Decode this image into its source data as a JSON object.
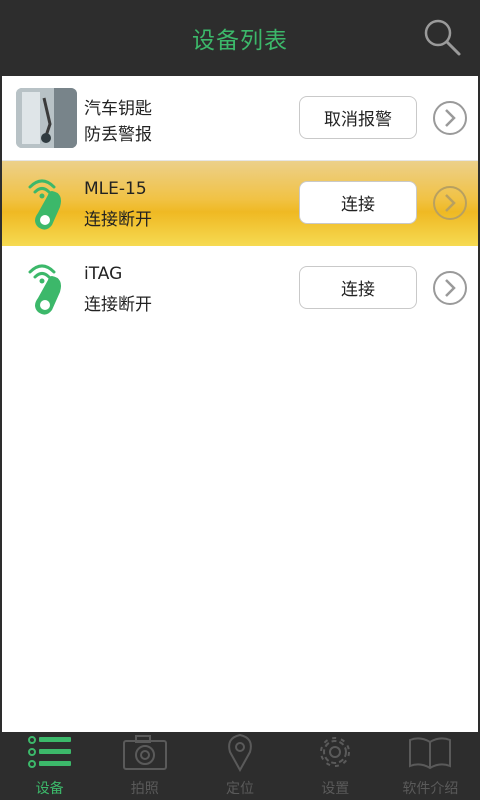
{
  "header": {
    "title": "设备列表",
    "search_icon": "search-icon"
  },
  "devices": [
    {
      "name": "汽车钥匙",
      "status": "防丢警报",
      "action": "取消报警",
      "icon": "car-key-photo",
      "selected": false
    },
    {
      "name": "MLE-15",
      "status": "连接断开",
      "action": "连接",
      "icon": "bluetooth-tag-icon",
      "selected": true
    },
    {
      "name": "iTAG",
      "status": "连接断开",
      "action": "连接",
      "icon": "bluetooth-tag-icon",
      "selected": false
    }
  ],
  "tabs": [
    {
      "label": "设备",
      "icon": "device-list-icon",
      "active": true
    },
    {
      "label": "拍照",
      "icon": "camera-icon",
      "active": false
    },
    {
      "label": "定位",
      "icon": "location-pin-icon",
      "active": false
    },
    {
      "label": "设置",
      "icon": "gear-icon",
      "active": false
    },
    {
      "label": "软件介绍",
      "icon": "book-icon",
      "active": false
    }
  ],
  "colors": {
    "accent": "#3cb86a",
    "header_bg": "#2d2d2d",
    "selected_row": "#f1c244"
  }
}
